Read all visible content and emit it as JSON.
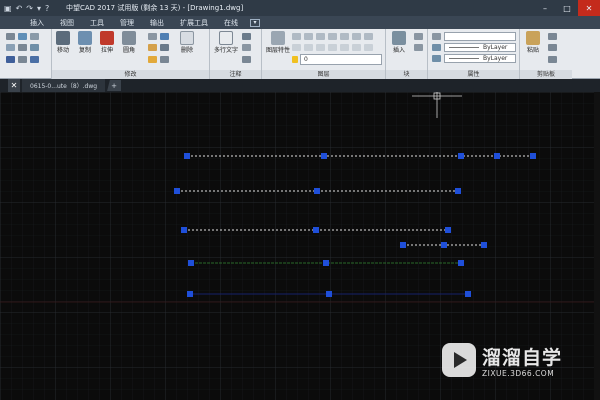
{
  "title_bar": {
    "title": "中望CAD 2017 试用版 (剩余 13 天) - [Drawing1.dwg]",
    "window_controls": [
      "minimize-icon",
      "maximize-icon",
      "close-icon"
    ]
  },
  "menu": {
    "items": [
      "",
      "插入",
      "视图",
      "工具",
      "管理",
      "输出",
      "扩展工具",
      "在线"
    ]
  },
  "ribbon": {
    "modify_panel": {
      "title": "修改",
      "tools": [
        "移动",
        "复制",
        "拉伸",
        "圆角",
        "删除"
      ]
    },
    "annotation_panel": {
      "title": "注释",
      "tools": [
        "多行文字"
      ]
    },
    "layers_panel": {
      "title": "图层",
      "layer_properties": "图层特性",
      "current_layer": "0"
    },
    "block_panel": {
      "title": "块",
      "insert": "插入"
    },
    "properties_panel": {
      "title": "属性",
      "linetype": "ByLayer",
      "lineweight": "ByLayer"
    },
    "clipboard_panel": {
      "title": "剪贴板",
      "paste": "粘贴"
    }
  },
  "tabs": {
    "open_file": "0615-0...ute（8）.dwg"
  },
  "watermark": {
    "title": "溜溜自学",
    "url": "ZIXUE.3D66.COM"
  },
  "colors": {
    "canvas_bg": "#0b0b0b",
    "grip": "#1f4fd9",
    "line_dashed": "#e0e0e0",
    "line_green": "#2a6a2a",
    "line_blue": "#16206a"
  }
}
